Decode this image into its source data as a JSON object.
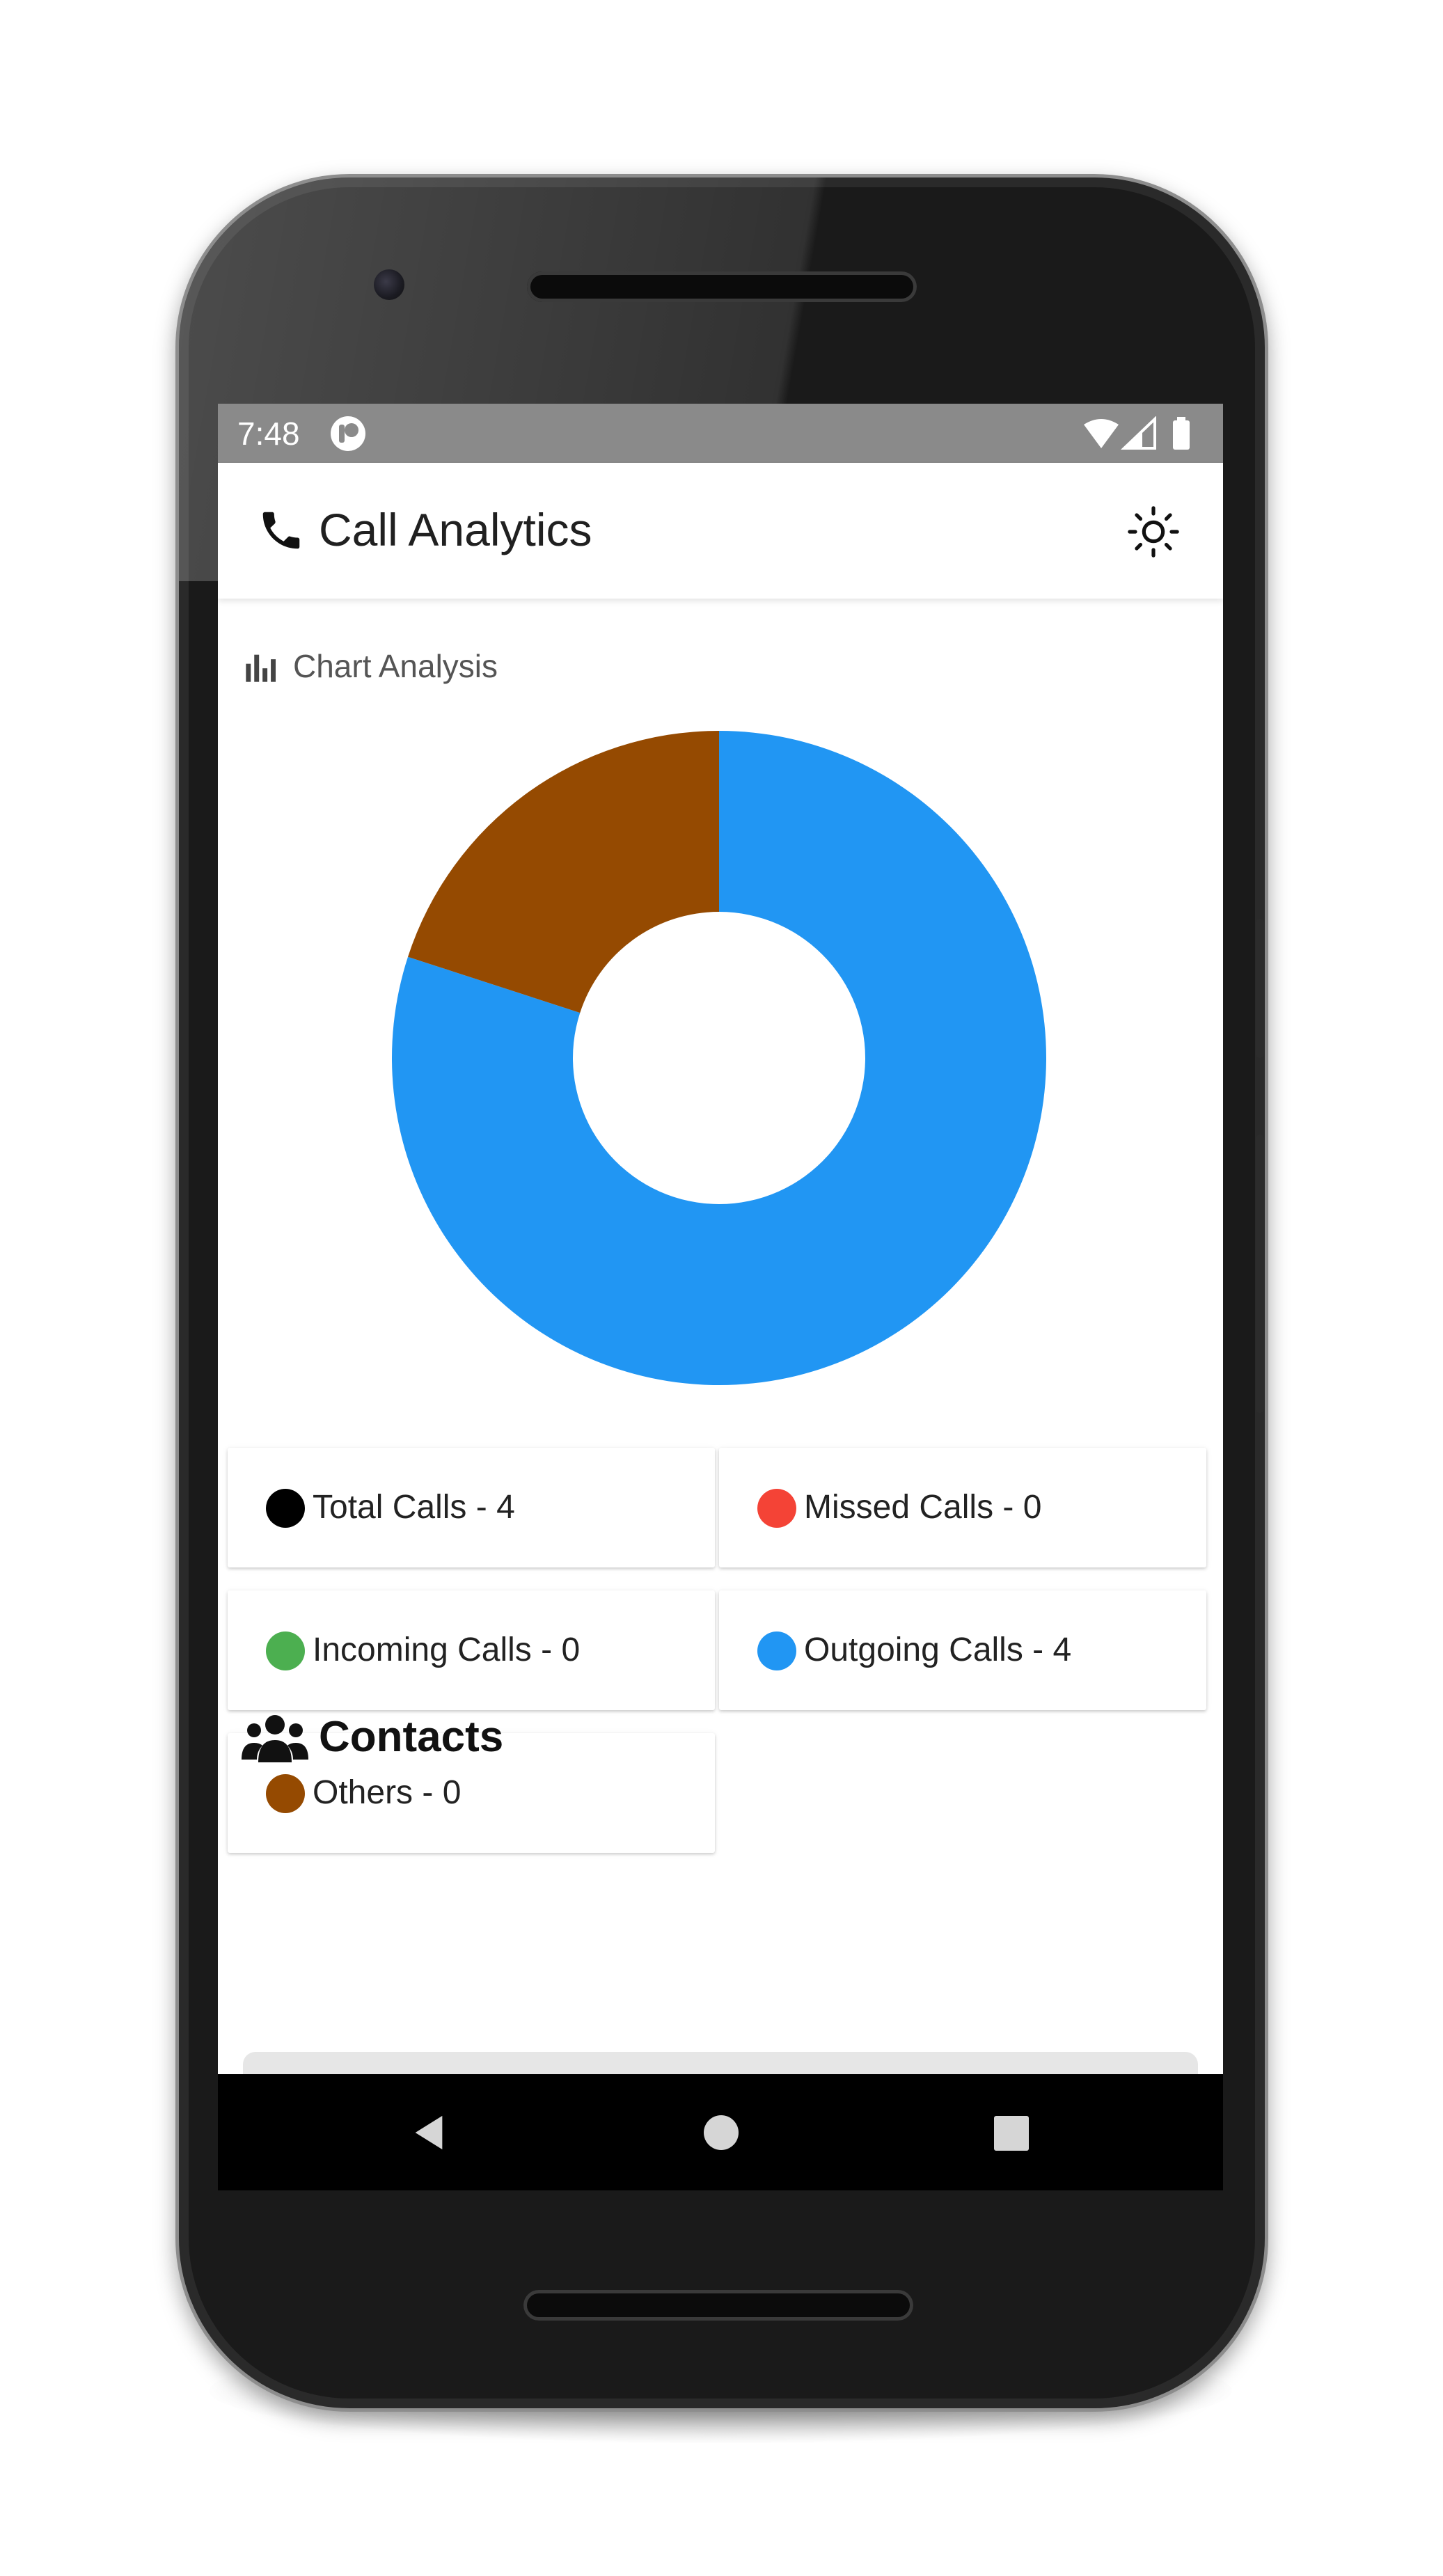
{
  "status_bar": {
    "time": "7:48"
  },
  "app_bar": {
    "title": "Call Analytics",
    "phone_icon": "phone-icon",
    "theme_icon": "sun-icon"
  },
  "chart_section": {
    "title": "Chart Analysis",
    "icon": "bar-chart-icon"
  },
  "chart_data": {
    "type": "pie",
    "variant": "donut",
    "slices": [
      {
        "label": "Outgoing Calls",
        "value": 4,
        "color": "#2196F3"
      },
      {
        "label": "Others",
        "value": 1,
        "color": "#954A01"
      }
    ]
  },
  "legend": [
    {
      "label": "Total Calls - 4",
      "color": "#000000"
    },
    {
      "label": "Missed Calls - 0",
      "color": "#F44336"
    },
    {
      "label": "Incoming Calls - 0",
      "color": "#4CAF50"
    },
    {
      "label": "Outgoing Calls - 4",
      "color": "#2196F3"
    },
    {
      "label": "Others - 0",
      "color": "#954A01"
    }
  ],
  "contacts": {
    "title": "Contacts",
    "icon": "users-icon"
  },
  "nav": {
    "back_icon": "back-icon",
    "home_icon": "home-icon",
    "recent_icon": "recent-apps-icon"
  }
}
